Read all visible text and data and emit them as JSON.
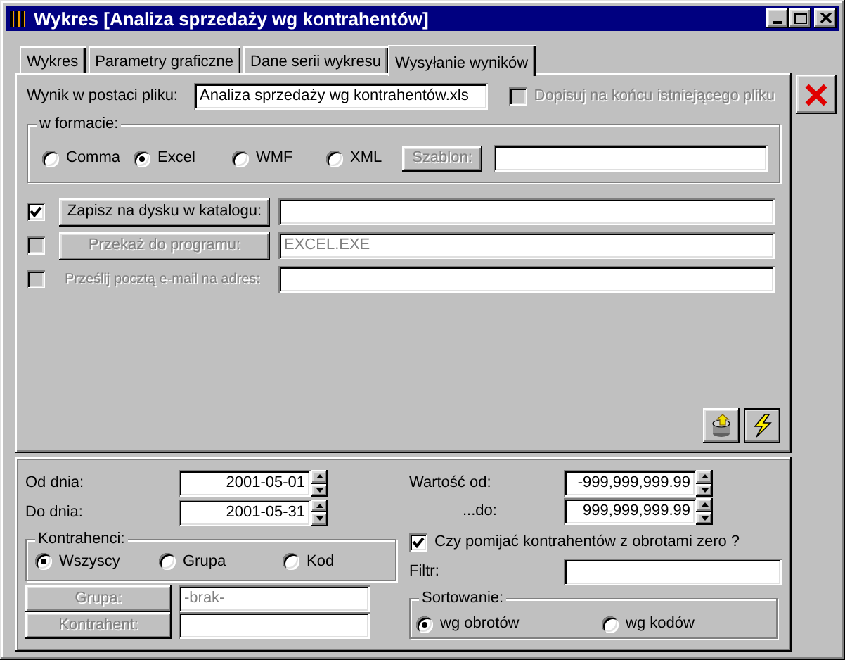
{
  "window": {
    "title": "Wykres [Analiza sprzedaży wg kontrahentów]"
  },
  "tabs": [
    {
      "label": "Wykres",
      "selected": false
    },
    {
      "label": "Parametry graficzne",
      "selected": false
    },
    {
      "label": "Dane serii wykresu",
      "selected": false
    },
    {
      "label": "Wysyłanie wyników",
      "selected": true
    }
  ],
  "output": {
    "file_label": "Wynik w postaci pliku:",
    "file_value": "Analiza sprzedaży wg kontrahentów.xls",
    "append": {
      "label": "Dopisuj na końcu istniejącego pliku",
      "checked": false,
      "disabled": true
    },
    "format": {
      "legend": "w formacie:",
      "options": [
        {
          "label": "Comma",
          "selected": false
        },
        {
          "label": "Excel",
          "selected": true
        },
        {
          "label": "WMF",
          "selected": false
        },
        {
          "label": "XML",
          "selected": false
        }
      ],
      "template_button": {
        "label": "Szablon:",
        "disabled": true
      }
    },
    "destinations": [
      {
        "kind": "button",
        "label": "Zapisz na dysku w katalogu:",
        "checked": true,
        "disabled": false
      },
      {
        "kind": "button",
        "label": "Przekaż do programu:",
        "checked": false,
        "disabled": true,
        "value": "EXCEL.EXE"
      },
      {
        "kind": "label",
        "label": "Prześlij pocztą e-mail na adres:",
        "checked": false,
        "disabled": true
      }
    ]
  },
  "filters": {
    "date_from": {
      "label": "Od dnia:",
      "value": "2001-05-01"
    },
    "date_to": {
      "label": "Do dnia:",
      "value": "2001-05-31"
    },
    "contractors": {
      "legend": "Kontrahenci:",
      "options": [
        {
          "label": "Wszyscy",
          "selected": true
        },
        {
          "label": "Grupa",
          "selected": false
        },
        {
          "label": "Kod",
          "selected": false
        }
      ]
    },
    "group": {
      "label": "Grupa:",
      "disabled": true,
      "value": "-brak-"
    },
    "contractor": {
      "label": "Kontrahent:",
      "disabled": true
    },
    "value_from": {
      "label": "Wartość od:",
      "value": "-999,999,999.99"
    },
    "value_to": {
      "label": "...do:",
      "value": "999,999,999.99"
    },
    "skip_zero": {
      "label": "Czy pomijać kontrahentów z obrotami zero ?",
      "checked": true
    },
    "filter": {
      "label": "Filtr:"
    },
    "sorting": {
      "legend": "Sortowanie:",
      "options": [
        {
          "label": "wg obrotów",
          "selected": true
        },
        {
          "label": "wg kodów",
          "selected": false
        }
      ]
    }
  }
}
